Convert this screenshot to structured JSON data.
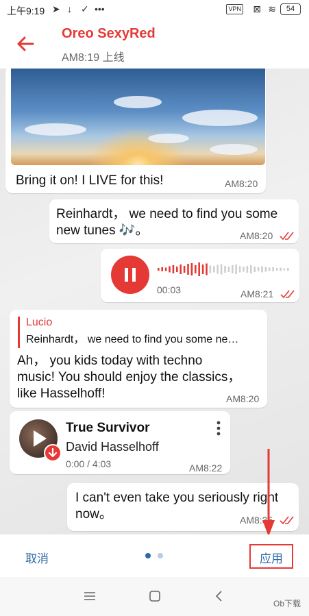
{
  "status_bar": {
    "time": "上午9:19",
    "vpn": "VPN",
    "battery": "54"
  },
  "header": {
    "title": "Oreo SexyRed",
    "subtitle": "AM8:19 上线"
  },
  "messages": {
    "m1": {
      "text": "Bring it on! I LIVE for this!",
      "time": "AM8:20"
    },
    "m2": {
      "text1": "Reinhardt， we need to find you some",
      "text2": "new tunes 🎶。",
      "time": "AM8:20"
    },
    "m3": {
      "duration": "00:03",
      "time": "AM8:21"
    },
    "m4": {
      "reply_name": "Lucio",
      "reply_text": "Reinhardt， we need to find you some ne…",
      "line1": "Ah， you kids today with techno",
      "line2": "music! You should enjoy the classics，",
      "line3": "like Hasselhoff!",
      "time": "AM8:20"
    },
    "m5": {
      "song": "True Survivor",
      "artist": "David Hasselhoff",
      "progress": "0:00 / 4:03",
      "time": "AM8:22"
    },
    "m6": {
      "line1": "I can't even take you seriously right",
      "line2": "now。",
      "time": "AM8:35"
    }
  },
  "bottom": {
    "cancel": "取消",
    "apply": "应用"
  },
  "watermark": "Ob下载",
  "colors": {
    "accent": "#e53935",
    "link": "#2b6aa6",
    "check": "#e53935"
  }
}
